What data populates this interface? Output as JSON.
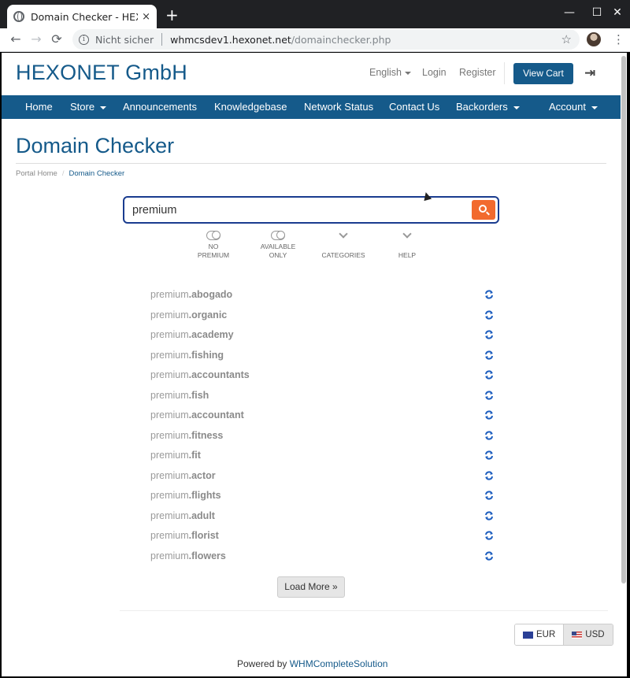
{
  "browser": {
    "tab_title": "Domain Checker - HEXONET GmbH",
    "tab_close": "×",
    "new_tab": "+",
    "win_min": "—",
    "win_max": "☐",
    "win_close": "✕",
    "back": "←",
    "forward": "→",
    "reload": "⟳",
    "security_label": "Nicht sicher",
    "url_host": "whmcsdev1.hexonet.net",
    "url_path": "/domainchecker.php",
    "star": "☆",
    "menu": "⋮"
  },
  "header": {
    "brand": "HEXONET GmbH",
    "language": "English",
    "login": "Login",
    "register": "Register",
    "view_cart": "View Cart"
  },
  "nav": {
    "items": [
      {
        "label": "Home",
        "dropdown": false
      },
      {
        "label": "Store",
        "dropdown": true
      },
      {
        "label": "Announcements",
        "dropdown": false
      },
      {
        "label": "Knowledgebase",
        "dropdown": false
      },
      {
        "label": "Network Status",
        "dropdown": false
      },
      {
        "label": "Contact Us",
        "dropdown": false
      },
      {
        "label": "Backorders",
        "dropdown": true
      },
      {
        "label": "Account",
        "dropdown": true
      }
    ]
  },
  "page": {
    "title": "Domain Checker",
    "breadcrumb": {
      "home": "Portal Home",
      "separator": "/",
      "current": "Domain Checker"
    }
  },
  "search": {
    "value": "premium"
  },
  "options": [
    {
      "line1": "NO",
      "line2": "PREMIUM",
      "kind": "toggle"
    },
    {
      "line1": "AVAILABLE",
      "line2": "ONLY",
      "kind": "toggle"
    },
    {
      "line1": "",
      "line2": "CATEGORIES",
      "kind": "chevron"
    },
    {
      "line1": "",
      "line2": "HELP",
      "kind": "chevron"
    }
  ],
  "results": {
    "base": "premium",
    "tlds": [
      ".abogado",
      ".organic",
      ".academy",
      ".fishing",
      ".accountants",
      ".fish",
      ".accountant",
      ".fitness",
      ".fit",
      ".actor",
      ".flights",
      ".adult",
      ".florist",
      ".flowers"
    ]
  },
  "load_more": "Load More »",
  "currencies": [
    {
      "code": "EUR",
      "active": false
    },
    {
      "code": "USD",
      "active": true
    }
  ],
  "footer": {
    "powered_prefix": "Powered by ",
    "powered_link": "WHMCompleteSolution"
  },
  "colors": {
    "brand_blue": "#155a8a",
    "search_orange": "#f26a2e",
    "search_border": "#1a3c8f",
    "refresh_blue": "#1f5fbf"
  }
}
